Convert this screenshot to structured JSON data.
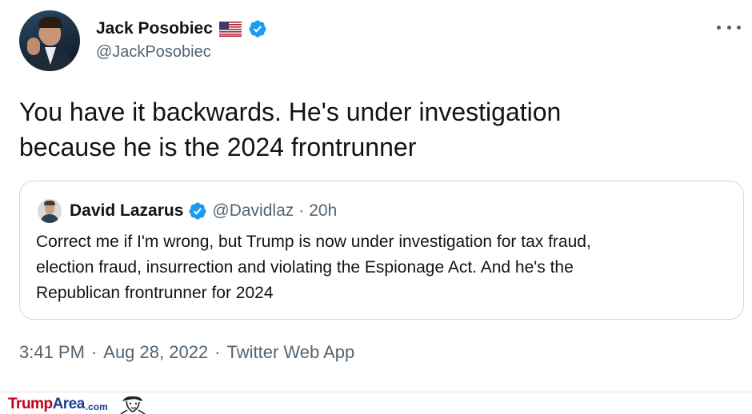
{
  "tweet": {
    "author_name": "Jack Posobiec",
    "author_handle": "@JackPosobiec",
    "flag_icon": "us-flag-icon",
    "verified_icon": "verified-badge-icon",
    "verified_color": "#1d9bf0",
    "text_line1": "You have it backwards. He's under investigation",
    "text_line2": "because he is the 2024 frontrunner",
    "time": "3:41 PM",
    "date": "Aug 28, 2022",
    "source": "Twitter Web App",
    "separator": "·"
  },
  "quoted": {
    "author_name": "David Lazarus",
    "author_handle": "@Davidlaz",
    "separator": "·",
    "age": "20h",
    "text_line1": "Correct me if I'm wrong, but Trump is now under investigation for tax fraud,",
    "text_line2": "election fraud, insurrection and violating the Espionage Act. And he's the",
    "text_line3": "Republican frontrunner for 2024"
  },
  "watermark": {
    "part1": "Trump",
    "part2": "Area",
    "part3": ".com"
  }
}
